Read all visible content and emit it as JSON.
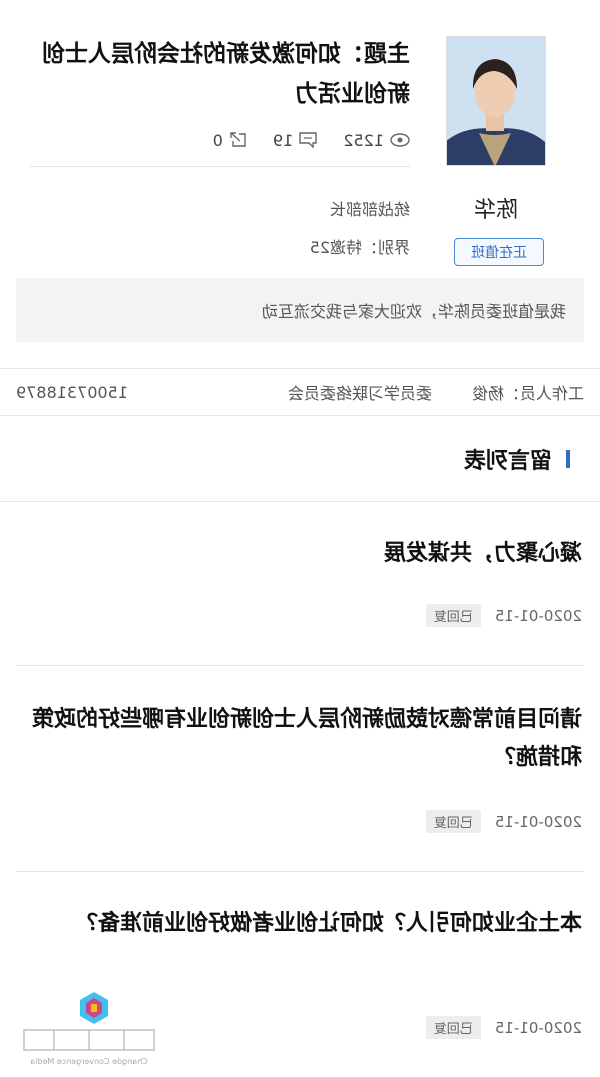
{
  "header": {
    "title": "主题：如何激发新的社会阶层人士创新创业活力",
    "stats": {
      "views": "1252",
      "comments": "19",
      "shares": "0"
    }
  },
  "member": {
    "name": "陈华",
    "role": "统战部部长",
    "sector": "界别：特邀25",
    "badge": "正在值班",
    "welcome": "我是值班委员陈华，欢迎大家与我交流互动"
  },
  "staff": {
    "person": "工作人员：杨俊",
    "dept": "委员学习联络委员会",
    "phone": "15007318879"
  },
  "section": {
    "title": "留言列表"
  },
  "messages": [
    {
      "question": "凝心聚力，共谋发展",
      "date": "2020-01-15",
      "status": "已回复"
    },
    {
      "question": "请问目前常德对鼓励新阶层人士创新创业有哪些好的政策和措施？",
      "date": "2020-01-15",
      "status": "已回复"
    },
    {
      "question": "本土企业如何引人？如何让创业者做好创业前准备？",
      "date": "2020-01-15",
      "status": "已回复"
    }
  ],
  "watermark": {
    "text": "Changde Convergence Media"
  },
  "colors": {
    "accent": "#2f6fc4",
    "background": "#ffffff",
    "panel": "#f3f3f3"
  }
}
